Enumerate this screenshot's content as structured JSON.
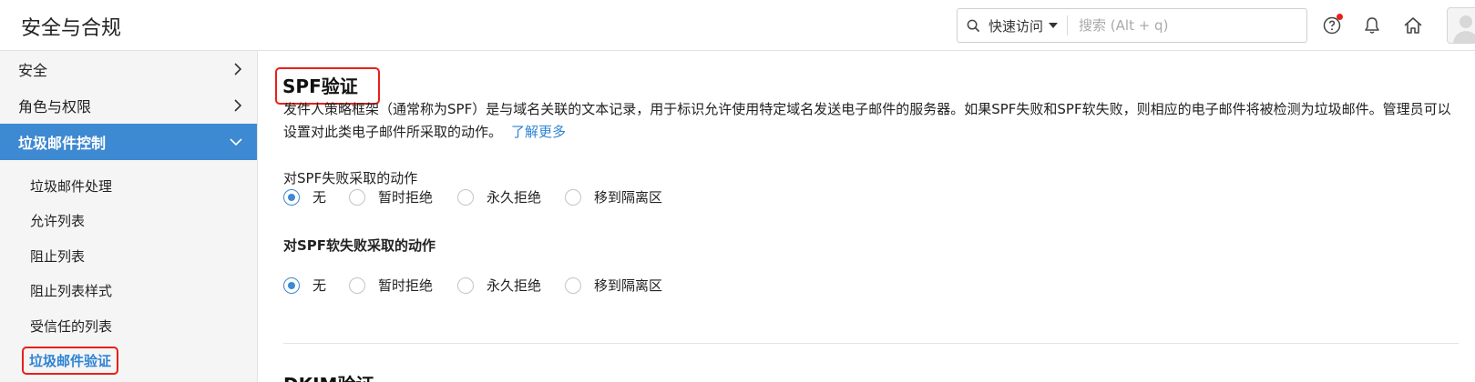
{
  "header": {
    "title": "安全与合规",
    "quick_access": "快速访问",
    "search_placeholder": "搜索 (Alt + q)"
  },
  "sidebar": {
    "items": [
      {
        "label": "安全"
      },
      {
        "label": "角色与权限"
      },
      {
        "label": "垃圾邮件控制"
      }
    ],
    "subitems": [
      {
        "label": "垃圾邮件处理"
      },
      {
        "label": "允许列表"
      },
      {
        "label": "阻止列表"
      },
      {
        "label": "阻止列表样式"
      },
      {
        "label": "受信任的列表"
      },
      {
        "label": "垃圾邮件验证"
      }
    ]
  },
  "main": {
    "section_title": "SPF验证",
    "description": "发件人策略框架（通常称为SPF）是与域名关联的文本记录，用于标识允许使用特定域名发送电子邮件的服务器。如果SPF失败和SPF软失败，则相应的电子邮件将被检测为垃圾邮件。管理员可以设置对此类电子邮件所采取的动作。",
    "learn_more": "了解更多",
    "group1": {
      "label": "对SPF失败采取的动作",
      "options": [
        "无",
        "暂时拒绝",
        "永久拒绝",
        "移到隔离区"
      ],
      "selected": "无"
    },
    "group2": {
      "label": "对SPF软失败采取的动作",
      "options": [
        "无",
        "暂时拒绝",
        "永久拒绝",
        "移到隔离区"
      ],
      "selected": "无"
    },
    "next_section_title": "DKIM验证"
  },
  "colors": {
    "accent": "#3d89d2",
    "highlight_border": "#e8201a",
    "link": "#2f83d4",
    "notification_dot": "#e8201a"
  }
}
